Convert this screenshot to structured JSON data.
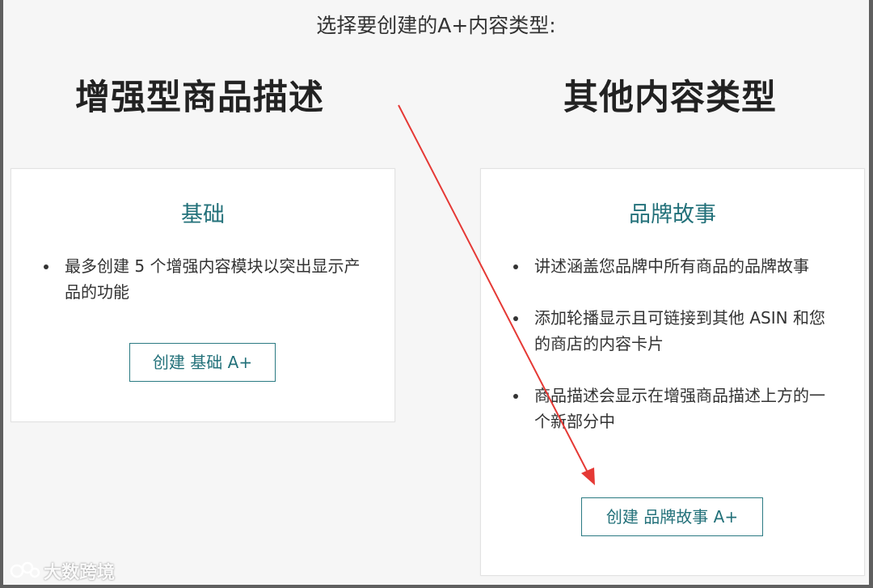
{
  "page": {
    "heading": "选择要创建的A+内容类型:"
  },
  "sections": {
    "enhanced_title": "增强型商品描述",
    "other_title": "其他内容类型"
  },
  "basic_card": {
    "title": "基础",
    "bullets": [
      "最多创建 5 个增强内容模块以突出显示产品的功能"
    ],
    "button_label": "创建 基础 A+"
  },
  "brand_card": {
    "title": "品牌故事",
    "bullets": [
      "讲述涵盖您品牌中所有商品的品牌故事",
      "添加轮播显示且可链接到其他 ASIN 和您的商店的内容卡片",
      "商品描述会显示在增强商品描述上方的一个新部分中"
    ],
    "button_label": "创建 品牌故事 A+"
  },
  "annotation": {
    "arrow_color": "#e53935"
  },
  "watermark": {
    "text": "大数跨境"
  },
  "colors": {
    "accent": "#23717a",
    "background": "#f6f6f6",
    "card": "#ffffff"
  }
}
